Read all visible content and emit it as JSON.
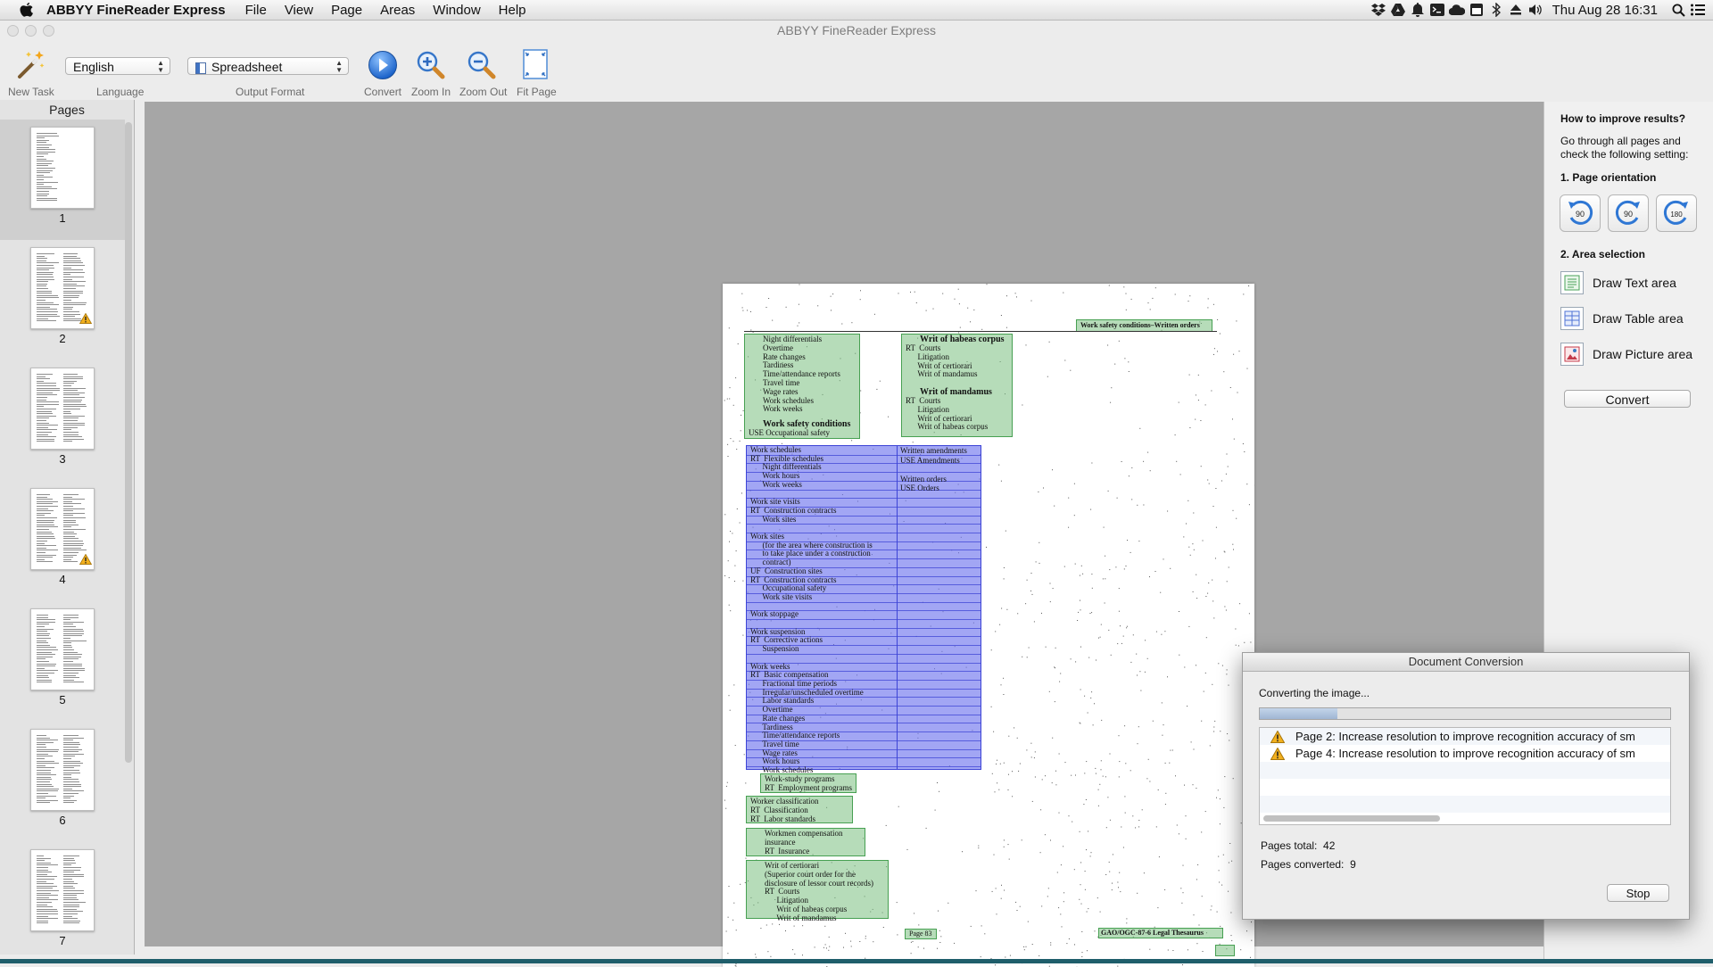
{
  "menubar": {
    "app_name": "ABBYY FineReader Express",
    "menus": [
      "File",
      "View",
      "Page",
      "Areas",
      "Window",
      "Help"
    ],
    "clock": "Thu Aug 28  16:31"
  },
  "window": {
    "title": "ABBYY FineReader Express"
  },
  "toolbar": {
    "new_task": "New Task",
    "language_label": "Language",
    "language_value": "English",
    "output_format_label": "Output Format",
    "output_format_value": "Spreadsheet",
    "convert": "Convert",
    "zoom_in": "Zoom In",
    "zoom_out": "Zoom Out",
    "fit_page": "Fit Page"
  },
  "pages_pane": {
    "header": "Pages",
    "pages": [
      {
        "number": "1",
        "warning": false
      },
      {
        "number": "2",
        "warning": true
      },
      {
        "number": "3",
        "warning": false
      },
      {
        "number": "4",
        "warning": true
      },
      {
        "number": "5",
        "warning": false
      },
      {
        "number": "6",
        "warning": false
      },
      {
        "number": "7",
        "warning": false
      }
    ]
  },
  "document": {
    "header_tag": "Work safety conditions–Written orders",
    "col1_top": "Night differentials\nOvertime\nRate changes\nTardiness\nTime/attendance reports\nTravel time\nWage rates\nWork schedules\nWork weeks",
    "col1_heading": "Work safety conditions",
    "col1_use": "USE Occupational safety",
    "col2_heading1": "Writ of habeas corpus",
    "col2_block1": "RT  Courts\n      Litigation\n      Writ of certiorari\n      Writ of mandamus",
    "col2_heading2": "Writ of mandamus",
    "col2_block2": "RT  Courts\n      Litigation\n      Writ of certiorari\n      Writ of habeas corpus",
    "table_left": "Work schedules\nRT  Flexible schedules\n      Night differentials\n      Work hours\n      Work weeks\n\nWork site visits\nRT  Construction contracts\n      Work sites\n\nWork sites\n      (for the area where construction is\n      to take place under a construction\n      contract)\nUF  Construction sites\nRT  Construction contracts\n      Occupational safety\n      Work site visits\n\nWork stoppage\n\nWork suspension\nRT  Corrective actions\n      Suspension\n\nWork weeks\nRT  Basic compensation\n      Fractional time periods\n      Irregular/unscheduled overtime\n      Labor standards\n      Overtime\n      Rate changes\n      Tardiness\n      Time/attendance reports\n      Travel time\n      Wage rates\n      Work hours\n      Work schedules",
    "table_right": "Written amendments\nUSE Amendments\n\nWritten orders\nUSE Orders",
    "bottom_blocks": [
      "Work-study programs\nRT  Employment programs",
      "Worker classification\nRT  Classification\nRT  Labor standards",
      "Workmen compensation\ninsurance\nRT  Insurance",
      "Writ of certiorari\n(Superior court order for the\ndisclosure of lessor court records)\nRT  Courts\n      Litigation\n      Writ of habeas corpus\n      Writ of mandamus"
    ],
    "page_label": "Page 83",
    "footer": "GAO/OGC-87-6 Legal Thesaurus"
  },
  "right_pane": {
    "heading": "How to improve results?",
    "intro": "Go through all pages and\ncheck the following setting:",
    "section1": "1. Page orientation",
    "rot_left": "90",
    "rot_right": "90",
    "rot_180": "180",
    "section2": "2. Area selection",
    "draw_text": "Draw Text area",
    "draw_table": "Draw Table area",
    "draw_picture": "Draw Picture area",
    "convert": "Convert"
  },
  "dialog": {
    "title": "Document Conversion",
    "status": "Converting the image...",
    "progress": 0.19,
    "messages": [
      "Page 2: Increase resolution to improve recognition accuracy of sm",
      "Page 4: Increase resolution to improve recognition accuracy of sm"
    ],
    "pages_total_label": "Pages total:",
    "pages_total": "42",
    "pages_converted_label": "Pages converted:",
    "pages_converted": "9",
    "stop": "Stop"
  },
  "colors": {
    "text_area": "#7abf80",
    "table_area": "#7076ee",
    "canvas": "#a6a6a6",
    "warning": "#f2b01e"
  }
}
